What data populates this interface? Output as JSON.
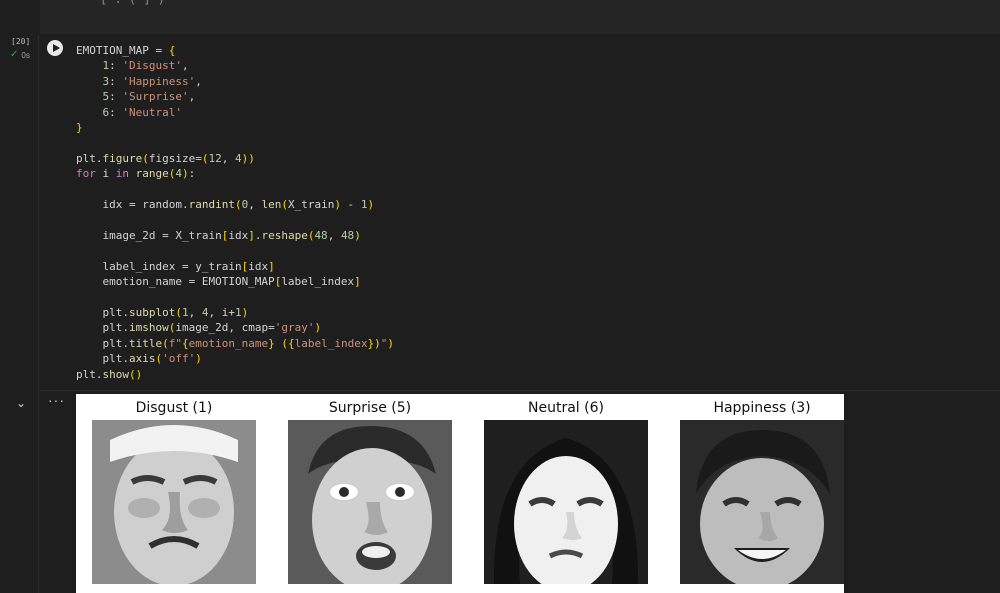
{
  "previous_cell": {
    "partial_text": "[ : ( ] )"
  },
  "cell": {
    "exec_count": "[20]",
    "exec_time": "0s",
    "code_lines": [
      "EMOTION_MAP = {",
      "    1: 'Disgust',",
      "    3: 'Happiness',",
      "    5: 'Surprise',",
      "    6: 'Neutral'",
      "}",
      "",
      "plt.figure(figsize=(12, 4))",
      "for i in range(4):",
      "",
      "    idx = random.randint(0, len(X_train) - 1)",
      "",
      "    image_2d = X_train[idx].reshape(48, 48)",
      "",
      "    label_index = y_train[idx]",
      "    emotion_name = EMOTION_MAP[label_index]",
      "",
      "    plt.subplot(1, 4, i+1)",
      "    plt.imshow(image_2d, cmap='gray')",
      "    plt.title(f\"{emotion_name} ({label_index})\")",
      "    plt.axis('off')",
      "plt.show()"
    ]
  },
  "output": {
    "panels": [
      {
        "title": "Disgust (1)",
        "tone": "#c8c8c8"
      },
      {
        "title": "Surprise (5)",
        "tone": "#bdbdbd"
      },
      {
        "title": "Neutral (6)",
        "tone": "#d6d6d6"
      },
      {
        "title": "Happiness (3)",
        "tone": "#a9a9a9"
      }
    ]
  },
  "icons": {
    "run": "play-icon",
    "status": "check-icon",
    "collapse": "chevron-down-icon",
    "more": "more-horizontal-icon"
  }
}
